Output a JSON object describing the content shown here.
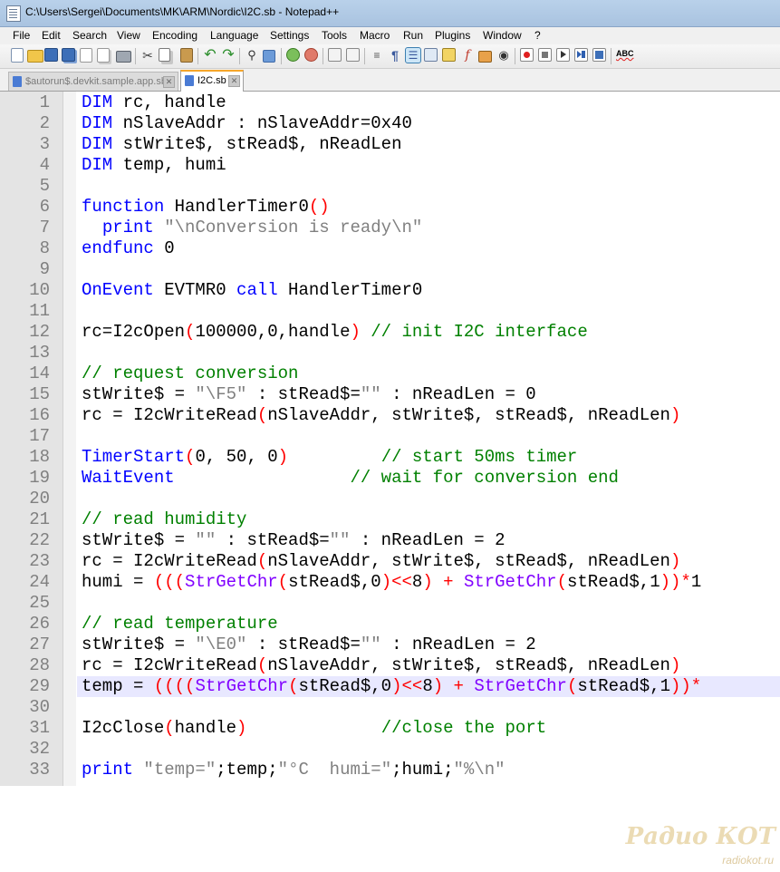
{
  "window": {
    "title": "C:\\Users\\Sergei\\Documents\\MK\\ARM\\Nordic\\I2C.sb - Notepad++"
  },
  "menu": [
    "File",
    "Edit",
    "Search",
    "View",
    "Encoding",
    "Language",
    "Settings",
    "Tools",
    "Macro",
    "Run",
    "Plugins",
    "Window",
    "?"
  ],
  "toolbar": {
    "icons": [
      "new-file-icon",
      "open-file-icon",
      "save-icon",
      "save-all-icon",
      "close-icon",
      "close-all-icon",
      "print-icon",
      "cut-icon",
      "copy-icon",
      "paste-icon",
      "undo-icon",
      "redo-icon",
      "find-icon",
      "replace-icon",
      "zoom-in-icon",
      "zoom-out-icon",
      "sync-vertical-icon",
      "sync-horizontal-icon",
      "word-wrap-icon",
      "show-all-chars-icon",
      "indent-guide-icon",
      "user-defined-language-icon",
      "document-map-icon",
      "function-list-icon",
      "folder-as-workspace-icon",
      "monitoring-icon",
      "record-macro-icon",
      "stop-record-icon",
      "play-macro-icon",
      "play-multiple-icon",
      "save-macro-icon",
      "spell-check-icon"
    ]
  },
  "tabs": [
    {
      "label": "$autorun$.devkit.sample.app.sb",
      "active": false
    },
    {
      "label": "I2C.sb",
      "active": true
    }
  ],
  "editor": {
    "current_line": 29,
    "lines": [
      {
        "n": "1",
        "parts": [
          [
            "k",
            "DIM"
          ],
          [
            "n",
            " rc, handle"
          ]
        ]
      },
      {
        "n": "2",
        "parts": [
          [
            "k",
            "DIM"
          ],
          [
            "n",
            " nSlaveAddr : nSlaveAddr=0x40"
          ]
        ]
      },
      {
        "n": "3",
        "parts": [
          [
            "k",
            "DIM"
          ],
          [
            "n",
            " stWrite$, stRead$, nReadLen"
          ]
        ]
      },
      {
        "n": "4",
        "parts": [
          [
            "k",
            "DIM"
          ],
          [
            "n",
            " temp, humi"
          ]
        ]
      },
      {
        "n": "5",
        "parts": []
      },
      {
        "n": "6",
        "parts": [
          [
            "k",
            "function"
          ],
          [
            "n",
            " HandlerTimer0"
          ],
          [
            "p",
            "()"
          ]
        ]
      },
      {
        "n": "7",
        "parts": [
          [
            "n",
            "  "
          ],
          [
            "k",
            "print"
          ],
          [
            "n",
            " "
          ],
          [
            "s",
            "\"\\nConversion is ready\\n\""
          ]
        ]
      },
      {
        "n": "8",
        "parts": [
          [
            "k",
            "endfunc"
          ],
          [
            "n",
            " 0"
          ]
        ]
      },
      {
        "n": "9",
        "parts": []
      },
      {
        "n": "10",
        "parts": [
          [
            "k",
            "OnEvent"
          ],
          [
            "n",
            " EVTMR0 "
          ],
          [
            "k",
            "call"
          ],
          [
            "n",
            " HandlerTimer0"
          ]
        ]
      },
      {
        "n": "11",
        "parts": []
      },
      {
        "n": "12",
        "parts": [
          [
            "n",
            "rc=I2cOpen"
          ],
          [
            "p",
            "("
          ],
          [
            "n",
            "100000,0,handle"
          ],
          [
            "p",
            ")"
          ],
          [
            "n",
            " "
          ],
          [
            "c",
            "// init I2C interface"
          ]
        ]
      },
      {
        "n": "13",
        "parts": []
      },
      {
        "n": "14",
        "parts": [
          [
            "c",
            "// request conversion"
          ]
        ]
      },
      {
        "n": "15",
        "parts": [
          [
            "n",
            "stWrite$ = "
          ],
          [
            "s",
            "\"\\F5\""
          ],
          [
            "n",
            " : stRead$="
          ],
          [
            "s",
            "\"\""
          ],
          [
            "n",
            " : nReadLen = 0"
          ]
        ]
      },
      {
        "n": "16",
        "parts": [
          [
            "n",
            "rc = I2cWriteRead"
          ],
          [
            "p",
            "("
          ],
          [
            "n",
            "nSlaveAddr, stWrite$, stRead$, nReadLen"
          ],
          [
            "p",
            ")"
          ]
        ]
      },
      {
        "n": "17",
        "parts": []
      },
      {
        "n": "18",
        "parts": [
          [
            "k",
            "TimerStart"
          ],
          [
            "p",
            "("
          ],
          [
            "n",
            "0, 50, 0"
          ],
          [
            "p",
            ")"
          ],
          [
            "n",
            "         "
          ],
          [
            "c",
            "// start 50ms timer"
          ]
        ]
      },
      {
        "n": "19",
        "parts": [
          [
            "k",
            "WaitEvent"
          ],
          [
            "n",
            "                 "
          ],
          [
            "c",
            "// wait for conversion end"
          ]
        ]
      },
      {
        "n": "20",
        "parts": []
      },
      {
        "n": "21",
        "parts": [
          [
            "c",
            "// read humidity"
          ]
        ]
      },
      {
        "n": "22",
        "parts": [
          [
            "n",
            "stWrite$ = "
          ],
          [
            "s",
            "\"\""
          ],
          [
            "n",
            " : stRead$="
          ],
          [
            "s",
            "\"\""
          ],
          [
            "n",
            " : nReadLen = 2"
          ]
        ]
      },
      {
        "n": "23",
        "parts": [
          [
            "n",
            "rc = I2cWriteRead"
          ],
          [
            "p",
            "("
          ],
          [
            "n",
            "nSlaveAddr, stWrite$, stRead$, nReadLen"
          ],
          [
            "p",
            ")"
          ]
        ]
      },
      {
        "n": "24",
        "parts": [
          [
            "n",
            "humi = "
          ],
          [
            "p",
            "((("
          ],
          [
            "f",
            "StrGetChr"
          ],
          [
            "p",
            "("
          ],
          [
            "n",
            "stRead$,0"
          ],
          [
            "p",
            ")<<"
          ],
          [
            "n",
            "8"
          ],
          [
            "p",
            ")"
          ],
          [
            "n",
            " "
          ],
          [
            "p",
            "+"
          ],
          [
            "n",
            " "
          ],
          [
            "f",
            "StrGetChr"
          ],
          [
            "p",
            "("
          ],
          [
            "n",
            "stRead$,1"
          ],
          [
            "p",
            "))*"
          ],
          [
            "n",
            "1"
          ]
        ]
      },
      {
        "n": "25",
        "parts": []
      },
      {
        "n": "26",
        "parts": [
          [
            "c",
            "// read temperature"
          ]
        ]
      },
      {
        "n": "27",
        "parts": [
          [
            "n",
            "stWrite$ = "
          ],
          [
            "s",
            "\"\\E0\""
          ],
          [
            "n",
            " : stRead$="
          ],
          [
            "s",
            "\"\""
          ],
          [
            "n",
            " : nReadLen = 2"
          ]
        ]
      },
      {
        "n": "28",
        "parts": [
          [
            "n",
            "rc = I2cWriteRead"
          ],
          [
            "p",
            "("
          ],
          [
            "n",
            "nSlaveAddr, stWrite$, stRead$, nReadLen"
          ],
          [
            "p",
            ")"
          ]
        ]
      },
      {
        "n": "29",
        "parts": [
          [
            "n",
            "temp = "
          ],
          [
            "p",
            "(((("
          ],
          [
            "f",
            "StrGetChr"
          ],
          [
            "p",
            "("
          ],
          [
            "n",
            "stRead$,0"
          ],
          [
            "p",
            ")<<"
          ],
          [
            "n",
            "8"
          ],
          [
            "p",
            ")"
          ],
          [
            "n",
            " "
          ],
          [
            "p",
            "+"
          ],
          [
            "n",
            " "
          ],
          [
            "f",
            "StrGetChr"
          ],
          [
            "p",
            "("
          ],
          [
            "n",
            "stRead$,1"
          ],
          [
            "p",
            "))*"
          ]
        ]
      },
      {
        "n": "30",
        "parts": []
      },
      {
        "n": "31",
        "parts": [
          [
            "n",
            "I2cClose"
          ],
          [
            "p",
            "("
          ],
          [
            "n",
            "handle"
          ],
          [
            "p",
            ")"
          ],
          [
            "n",
            "             "
          ],
          [
            "c",
            "//close the port"
          ]
        ]
      },
      {
        "n": "32",
        "parts": []
      },
      {
        "n": "33",
        "parts": [
          [
            "k",
            "print"
          ],
          [
            "n",
            " "
          ],
          [
            "s",
            "\"temp=\""
          ],
          [
            "n",
            ";temp;"
          ],
          [
            "s",
            "\"°C  humi=\""
          ],
          [
            "n",
            ";humi;"
          ],
          [
            "s",
            "\"%\\n\""
          ]
        ]
      }
    ]
  },
  "watermark": {
    "line1": "Радио КОТ",
    "line2": "radiokot.ru"
  }
}
